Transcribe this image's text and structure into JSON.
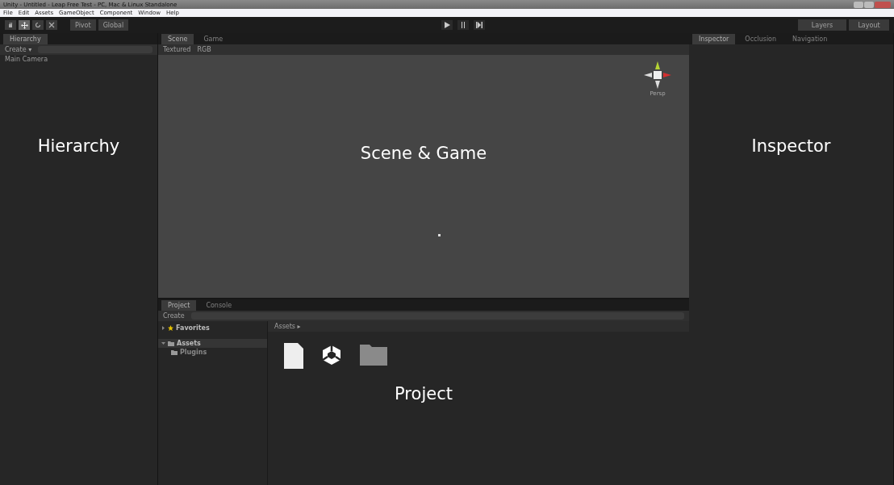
{
  "window": {
    "title": "Unity - Untitled - Leap Free Test - PC, Mac & Linux Standalone"
  },
  "menu": [
    "File",
    "Edit",
    "Assets",
    "GameObject",
    "Component",
    "Window",
    "Help"
  ],
  "toolbar": {
    "tools": [
      {
        "kind": "hand",
        "selected": false
      },
      {
        "kind": "move",
        "selected": true
      },
      {
        "kind": "rotate",
        "selected": false
      },
      {
        "kind": "scale",
        "selected": false
      }
    ],
    "pivot": "Pivot",
    "space": "Global",
    "play": [
      {
        "kind": "play"
      },
      {
        "kind": "pause"
      },
      {
        "kind": "step"
      }
    ],
    "layers": "Layers",
    "layout": "Layout"
  },
  "hierarchy": {
    "tab": "Hierarchy",
    "create": "Create ▾",
    "items": [
      "Main Camera"
    ],
    "overlay": "Hierarchy"
  },
  "scene": {
    "tabs": [
      {
        "label": "Scene",
        "selected": true
      },
      {
        "label": "Game",
        "selected": false
      }
    ],
    "shading": "Textured",
    "mode": "RGB",
    "gizmo_label": "Persp",
    "overlay": "Scene & Game"
  },
  "inspector": {
    "tabs": [
      {
        "label": "Inspector",
        "selected": true
      },
      {
        "label": "Occlusion",
        "selected": false
      },
      {
        "label": "Navigation",
        "selected": false
      }
    ],
    "overlay": "Inspector"
  },
  "project": {
    "tabs": [
      {
        "label": "Project",
        "selected": true
      },
      {
        "label": "Console",
        "selected": false
      }
    ],
    "create": "Create",
    "tree": [
      {
        "label": "Favorites",
        "kind": "favorites"
      },
      {
        "label": "Assets",
        "kind": "folder",
        "children": [
          {
            "label": "Plugins",
            "kind": "folder"
          }
        ]
      }
    ],
    "breadcrumb": "Assets ▸",
    "assets": [
      {
        "kind": "file"
      },
      {
        "kind": "unity"
      },
      {
        "kind": "folder"
      }
    ],
    "overlay": "Project"
  }
}
